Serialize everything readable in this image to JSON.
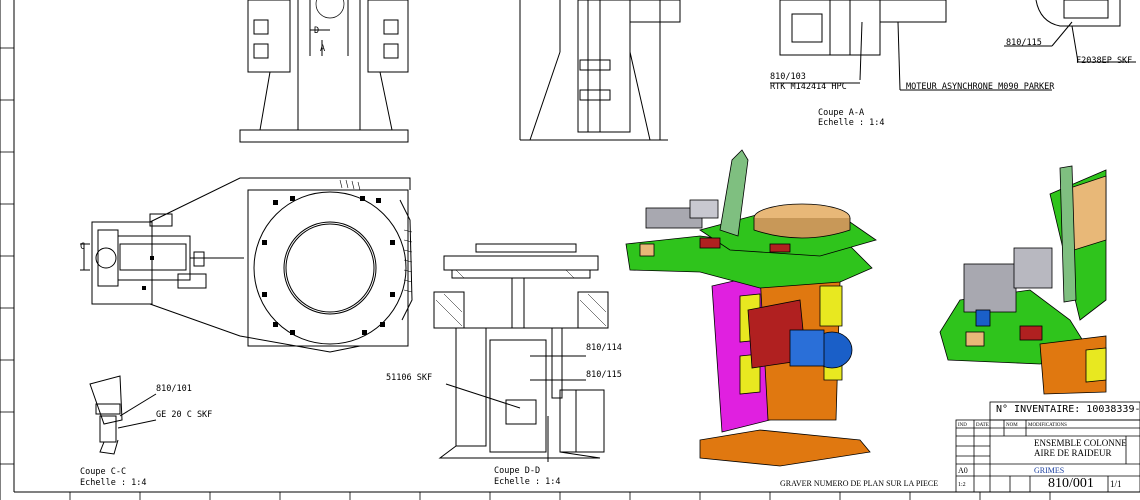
{
  "labels": {
    "ref_810_115_top": "810/115",
    "ref_f2038ep": "F2038EP SKF",
    "ref_810_103": "810/103",
    "ref_rtk": "RTK M142414 HPC",
    "ref_moteur": "MOTEUR ASYNCHRONE M090 PARKER",
    "coupe_aa": "Coupe A-A",
    "echelle_aa": "Echelle :  1:4",
    "ref_810_114": "810/114",
    "ref_810_115_mid": "810/115",
    "ref_51106": "51106 SKF",
    "coupe_dd": "Coupe D-D",
    "echelle_dd": "Echelle :  1:4",
    "ref_810_101": "810/101",
    "ref_ge20c": "GE 20 C SKF",
    "coupe_cc": "Coupe C-C",
    "echelle_cc": "Echelle :  1:4",
    "dim_d": "D",
    "dim_a": "A",
    "dim_c": "C",
    "graver": "GRAVER NUMERO DE PLAN SUR LA PIECE"
  },
  "title_block": {
    "inventaire": "N° INVENTAIRE: 10038339-1",
    "title_line1": "ENSEMBLE COLONNE",
    "title_line2": "AIRE DE RAIDEUR",
    "plan_number": "810/001",
    "sheet": "1/1",
    "format": "A0",
    "scale": "1:2",
    "company": "GRIMES",
    "mod_header": "MODIFICATIONS",
    "ind": "IND",
    "date": "DATE",
    "nom": "NOM"
  },
  "colors": {
    "line": "#000000",
    "green": "#2fc41c",
    "orange": "#e07810",
    "magenta": "#e020e0",
    "yellow": "#e8e820",
    "red": "#b02020",
    "tan": "#e8b878",
    "blue_motor": "#1a5fc8",
    "grey": "#a8a8b0"
  }
}
